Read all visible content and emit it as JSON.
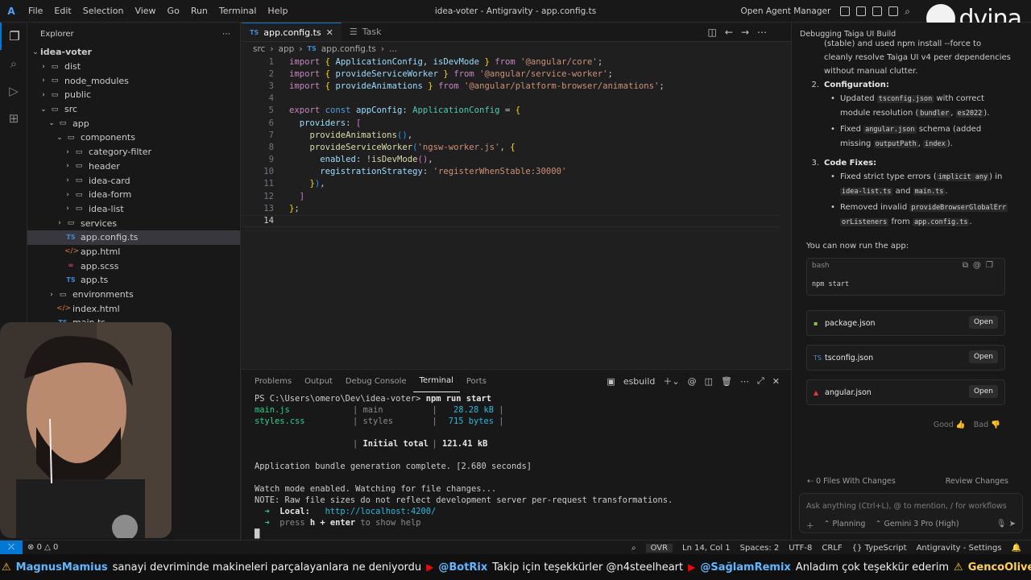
{
  "menu": [
    "File",
    "Edit",
    "Selection",
    "View",
    "Go",
    "Run",
    "Terminal",
    "Help"
  ],
  "window_title": "idea-voter - Antigravity - app.config.ts",
  "open_agent_manager": "Open Agent Manager",
  "watermark": "dvina",
  "explorer": {
    "title": "Explorer",
    "root": "idea-voter",
    "items": [
      {
        "label": "dist",
        "depth": 1,
        "type": "folder",
        "open": false
      },
      {
        "label": "node_modules",
        "depth": 1,
        "type": "folder",
        "open": false
      },
      {
        "label": "public",
        "depth": 1,
        "type": "folder",
        "open": false
      },
      {
        "label": "src",
        "depth": 1,
        "type": "folder",
        "open": true
      },
      {
        "label": "app",
        "depth": 2,
        "type": "folder",
        "open": true
      },
      {
        "label": "components",
        "depth": 3,
        "type": "folder",
        "open": true
      },
      {
        "label": "category-filter",
        "depth": 4,
        "type": "folder",
        "open": false
      },
      {
        "label": "header",
        "depth": 4,
        "type": "folder",
        "open": false
      },
      {
        "label": "idea-card",
        "depth": 4,
        "type": "folder",
        "open": false
      },
      {
        "label": "idea-form",
        "depth": 4,
        "type": "folder",
        "open": false
      },
      {
        "label": "idea-list",
        "depth": 4,
        "type": "folder",
        "open": false
      },
      {
        "label": "services",
        "depth": 3,
        "type": "folder",
        "open": false
      },
      {
        "label": "app.config.ts",
        "depth": 3,
        "type": "ts",
        "selected": true
      },
      {
        "label": "app.html",
        "depth": 3,
        "type": "html"
      },
      {
        "label": "app.scss",
        "depth": 3,
        "type": "scss"
      },
      {
        "label": "app.ts",
        "depth": 3,
        "type": "ts"
      },
      {
        "label": "environments",
        "depth": 2,
        "type": "folder",
        "open": false
      },
      {
        "label": "index.html",
        "depth": 2,
        "type": "html"
      },
      {
        "label": "main.ts",
        "depth": 2,
        "type": "ts"
      }
    ]
  },
  "editor": {
    "tabs": [
      {
        "label": "app.config.ts",
        "active": true
      },
      {
        "label": "Task",
        "active": false
      }
    ],
    "breadcrumb": [
      "src",
      "app",
      "app.config.ts",
      "..."
    ],
    "lines": [
      "1",
      "2",
      "3",
      "4",
      "5",
      "6",
      "7",
      "8",
      "9",
      "10",
      "11",
      "12",
      "13",
      "14"
    ]
  },
  "panel": {
    "tabs": [
      "Problems",
      "Output",
      "Debug Console",
      "Terminal",
      "Ports"
    ],
    "active_tab": "Terminal",
    "terminal_name": "esbuild",
    "prompt": "PS C:\\Users\\omero\\Dev\\idea-voter> ",
    "command": "npm run start",
    "rows": [
      {
        "file": "main.js",
        "name": "main",
        "size": "28.28 kB"
      },
      {
        "file": "styles.css",
        "name": "styles",
        "size": "715 bytes"
      }
    ],
    "initial_total_label": "Initial total",
    "initial_total": "121.41 kB",
    "bundle_complete": "Application bundle generation complete. [2.680 seconds]",
    "watch_line": "Watch mode enabled. Watching for file changes...",
    "note_line": "NOTE: Raw file sizes do not reflect development server per-request transformations.",
    "local_label": "Local:",
    "local_url": "http://localhost:4200/",
    "help_pre": "press ",
    "help_key": "h + enter",
    "help_post": " to show help"
  },
  "agent": {
    "title": "Debugging Taiga UI Build",
    "lines": {
      "l0": "(stable) and used npm install --force to",
      "l1": "cleanly resolve Taiga UI v4 peer dependencies",
      "l2": "without manual clutter.",
      "h2": "Configuration:",
      "b1a": "Updated ",
      "b1c": "tsconfig.json",
      "b1b": " with correct",
      "b1d": "module resolution (",
      "b1e": "bundler",
      "b1f": ", ",
      "b1g": "es2022",
      "b1h": ").",
      "b2a": "Fixed ",
      "b2c": "angular.json",
      "b2b": " schema (added",
      "b2d": "missing ",
      "b2e": "outputPath",
      "b2f": ", ",
      "b2g": "index",
      "b2h": ").",
      "h3": "Code Fixes:",
      "b3a": "Fixed strict type errors (",
      "b3c": "implicit any",
      "b3b": ") in ",
      "b3d": "idea-list.ts",
      "b3e": " and ",
      "b3f": "main.ts",
      "b3g": ".",
      "b4a": "Removed invalid ",
      "b4c": "provideBrowserGlobalErr",
      "b4d": "orListeners",
      "b4e": " from ",
      "b4f": "app.config.ts",
      "b4g": ".",
      "run": "You can now run the app:"
    },
    "code_lang": "bash",
    "code_cmd": "npm start",
    "files": [
      {
        "name": "package.json",
        "open": "Open"
      },
      {
        "name": "tsconfig.json",
        "open": "Open"
      },
      {
        "name": "angular.json",
        "open": "Open"
      }
    ],
    "good": "Good",
    "bad": "Bad",
    "changes": "0 Files With Changes",
    "review": "Review Changes",
    "placeholder": "Ask anything (Ctrl+L), @ to mention, / for workflows",
    "mode": "Planning",
    "model": "Gemini 3 Pro (High)"
  },
  "status": {
    "errors": "0",
    "warnings": "0",
    "ovr": "OVR",
    "position": "Ln 14, Col 1",
    "spaces": "Spaces: 2",
    "encoding": "UTF-8",
    "eol": "CRLF",
    "language": "TypeScript",
    "settings": "Antigravity - Settings"
  },
  "ticker": {
    "u1": "MagnusMamius",
    "m1": "sanayi devriminde makineleri parçalayanlara ne deniyordu",
    "u2": "@BotRix",
    "m2": "Takip için teşekkürler @n4steelheart",
    "u3": "@SağlamRemix",
    "m3": "Anladım çok teşekkür ederim",
    "u4": "GencoOliveOil"
  }
}
